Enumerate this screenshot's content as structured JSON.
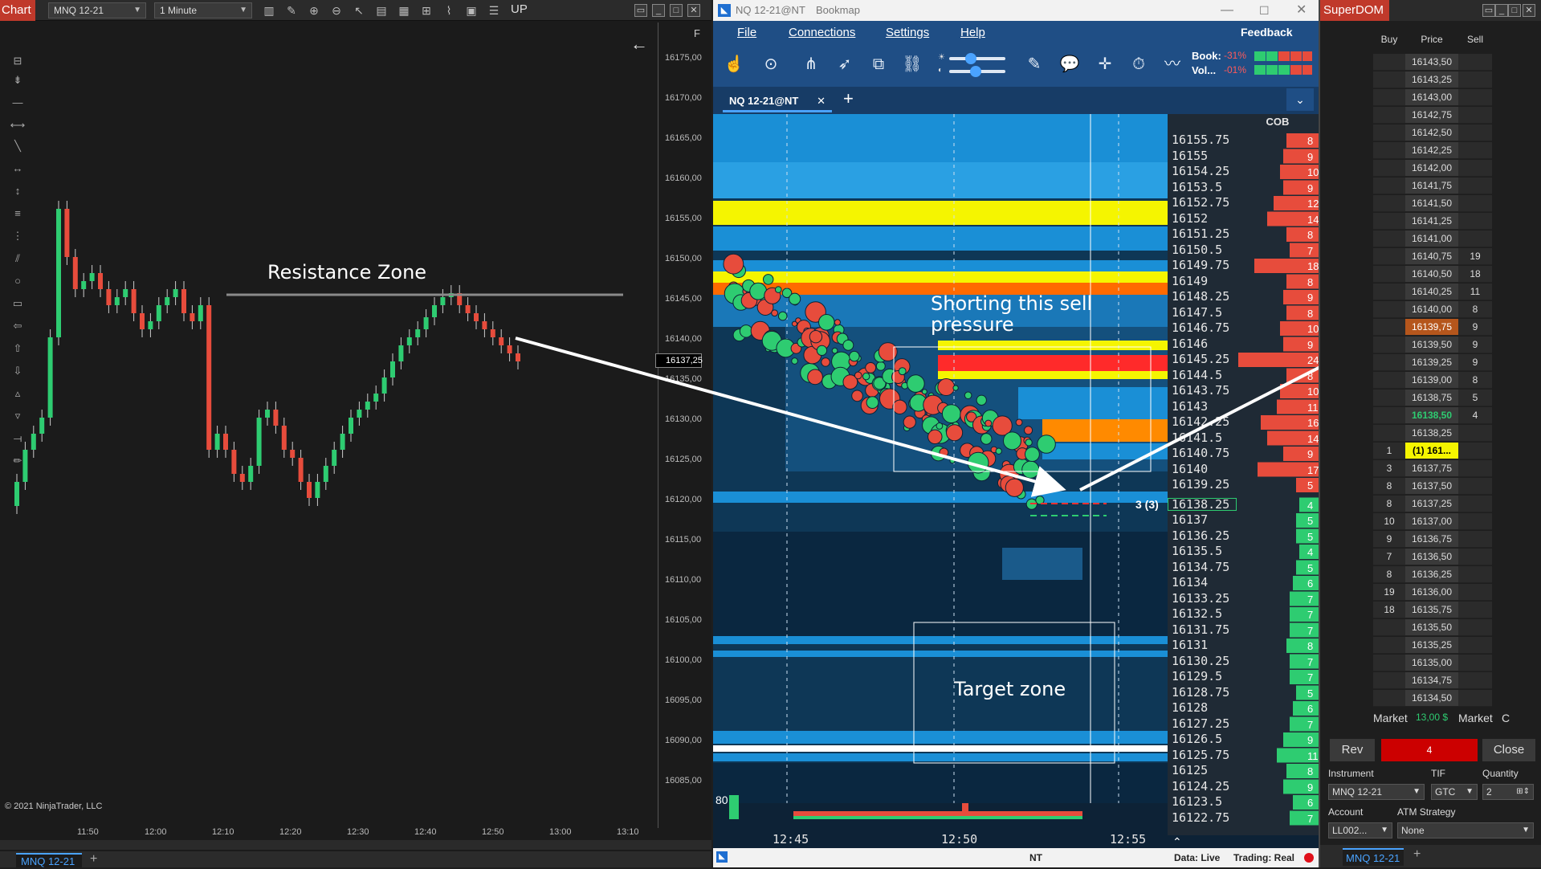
{
  "nt": {
    "chart_tab": "Chart",
    "instrument": "MNQ 12-21",
    "interval": "1 Minute",
    "up_label": "UP",
    "f_label": "F",
    "resistance_label": "Resistance Zone",
    "copyright": "© 2021 NinjaTrader, LLC",
    "price_marker": "16137,25",
    "bottom_tab": "MNQ 12-21",
    "y_ticks": [
      "16175,00",
      "16170,00",
      "16165,00",
      "16160,00",
      "16155,00",
      "16150,00",
      "16145,00",
      "16140,00",
      "16135,00",
      "16130,00",
      "16125,00",
      "16120,00",
      "16115,00",
      "16110,00",
      "16105,00",
      "16100,00",
      "16095,00",
      "16090,00",
      "16085,00"
    ],
    "x_ticks": [
      "11:50",
      "12:00",
      "12:10",
      "12:20",
      "12:30",
      "12:40",
      "12:50",
      "13:00",
      "13:10"
    ]
  },
  "bm": {
    "title": "NQ 12-21@NT",
    "app": "Bookmap",
    "menu": [
      "File",
      "Connections",
      "Settings",
      "Help"
    ],
    "feedback": "Feedback",
    "book_label": "Book:",
    "book_value": "-31%",
    "vol_label": "Vol...",
    "vol_value": "-01%",
    "tab": "NQ 12-21@NT",
    "cob": "COB",
    "prices": [
      "16155.75",
      "16155",
      "16154.25",
      "16153.5",
      "16152.75",
      "16152",
      "16151.25",
      "16150.5",
      "16149.75",
      "16149",
      "16148.25",
      "16147.5",
      "16146.75",
      "16146",
      "16145.25",
      "16144.5",
      "16143.75",
      "16143",
      "16142.25",
      "16141.5",
      "16140.75",
      "16140",
      "16139.25",
      "16138.25",
      "16137",
      "16136.25",
      "16135.5",
      "16134.75",
      "16134",
      "16133.25",
      "16132.5",
      "16131.75",
      "16131",
      "16130.25",
      "16129.5",
      "16128.75",
      "16128",
      "16127.25",
      "16126.5",
      "16125.75",
      "16125",
      "16124.25",
      "16123.5",
      "16122.75"
    ],
    "cob_values": [
      "8",
      "9",
      "10",
      "9",
      "12",
      "14",
      "8",
      "7",
      "18",
      "8",
      "9",
      "8",
      "10",
      "9",
      "24",
      "8",
      "10",
      "11",
      "16",
      "14",
      "9",
      "17",
      "5",
      "4",
      "5",
      "5",
      "4",
      "5",
      "6",
      "7",
      "7",
      "7",
      "8",
      "7",
      "7",
      "5",
      "6",
      "7",
      "9",
      "11",
      "8",
      "9",
      "6",
      "7"
    ],
    "annotation_short": "Shorting this sell pressure",
    "annotation_target": "Target zone",
    "position_label": "3 (3)",
    "volume_label": "80",
    "x_ticks": [
      "12:45",
      "12:50",
      "12:55"
    ],
    "nt_label": "NT",
    "data_status": "Data: Live",
    "trading_status": "Trading: Real"
  },
  "sd": {
    "title": "SuperDOM",
    "hdr_buy": "Buy",
    "hdr_price": "Price",
    "hdr_sell": "Sell",
    "rows": [
      {
        "buy": "",
        "price": "16143,50",
        "sell": ""
      },
      {
        "buy": "",
        "price": "16143,25",
        "sell": ""
      },
      {
        "buy": "",
        "price": "16143,00",
        "sell": ""
      },
      {
        "buy": "",
        "price": "16142,75",
        "sell": ""
      },
      {
        "buy": "",
        "price": "16142,50",
        "sell": ""
      },
      {
        "buy": "",
        "price": "16142,25",
        "sell": ""
      },
      {
        "buy": "",
        "price": "16142,00",
        "sell": ""
      },
      {
        "buy": "",
        "price": "16141,75",
        "sell": ""
      },
      {
        "buy": "",
        "price": "16141,50",
        "sell": ""
      },
      {
        "buy": "",
        "price": "16141,25",
        "sell": ""
      },
      {
        "buy": "",
        "price": "16141,00",
        "sell": ""
      },
      {
        "buy": "",
        "price": "16140,75",
        "sell": "19"
      },
      {
        "buy": "",
        "price": "16140,50",
        "sell": "18"
      },
      {
        "buy": "",
        "price": "16140,25",
        "sell": "11"
      },
      {
        "buy": "",
        "price": "16140,00",
        "sell": "8"
      },
      {
        "buy": "",
        "price": "16139,75",
        "sell": "9"
      },
      {
        "buy": "",
        "price": "16139,50",
        "sell": "9"
      },
      {
        "buy": "",
        "price": "16139,25",
        "sell": "9"
      },
      {
        "buy": "",
        "price": "16139,00",
        "sell": "8"
      },
      {
        "buy": "",
        "price": "16138,75",
        "sell": "5"
      },
      {
        "buy": "",
        "price": "16138,50",
        "sell": "4"
      },
      {
        "buy": "",
        "price": "16138,25",
        "sell": ""
      },
      {
        "buy": "1",
        "price": "(1) 161...",
        "sell": ""
      },
      {
        "buy": "3",
        "price": "16137,75",
        "sell": ""
      },
      {
        "buy": "8",
        "price": "16137,50",
        "sell": ""
      },
      {
        "buy": "8",
        "price": "16137,25",
        "sell": ""
      },
      {
        "buy": "10",
        "price": "16137,00",
        "sell": ""
      },
      {
        "buy": "9",
        "price": "16136,75",
        "sell": ""
      },
      {
        "buy": "7",
        "price": "16136,50",
        "sell": ""
      },
      {
        "buy": "8",
        "price": "16136,25",
        "sell": ""
      },
      {
        "buy": "19",
        "price": "16136,00",
        "sell": ""
      },
      {
        "buy": "18",
        "price": "16135,75",
        "sell": ""
      },
      {
        "buy": "",
        "price": "16135,50",
        "sell": ""
      },
      {
        "buy": "",
        "price": "16135,25",
        "sell": ""
      },
      {
        "buy": "",
        "price": "16135,00",
        "sell": ""
      },
      {
        "buy": "",
        "price": "16134,75",
        "sell": ""
      },
      {
        "buy": "",
        "price": "16134,50",
        "sell": ""
      }
    ],
    "market_buy": "Market",
    "pnl": "13,00 $",
    "market_sell": "Market",
    "c_label": "C",
    "rev": "Rev",
    "position": "4",
    "close": "Close",
    "instrument_label": "Instrument",
    "instrument": "MNQ 12-21",
    "tif_label": "TIF",
    "tif": "GTC",
    "qty_label": "Quantity",
    "qty": "2",
    "account_label": "Account",
    "account": "LL002...",
    "atm_label": "ATM Strategy",
    "atm": "None",
    "bottom_tab": "MNQ 12-21"
  },
  "colors": {
    "ninja_red": "#c0392b",
    "bm_blue": "#1f4e85",
    "bid_green": "#2ecc71",
    "ask_red": "#e74c3c",
    "heat_yellow": "#f5f500",
    "heat_orange": "#ff8a00"
  }
}
